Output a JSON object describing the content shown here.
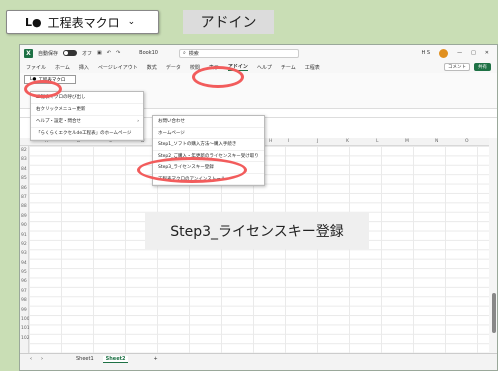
{
  "callout": {
    "icon": "L●",
    "label": "工程表マクロ",
    "chevron": "⌄"
  },
  "addin_tag": "アドイン",
  "window": {
    "titlebar": {
      "autosave": "自動保存",
      "autosave_state": "オフ",
      "filename": "Book10",
      "search_placeholder": "検索",
      "user_initials": "H S",
      "minimize": "—",
      "maximize": "□",
      "close": "✕"
    },
    "ribbon_tabs": [
      "ファイル",
      "ホーム",
      "挿入",
      "ページレイアウト",
      "数式",
      "データ",
      "校閲",
      "表示",
      "アドイン",
      "ヘルプ",
      "チーム",
      "工程表"
    ],
    "active_tab": "アドイン",
    "comment_button": "コメント",
    "share_button": "共有",
    "ribbon_button": "工程表マクロ",
    "column_headers": [
      "A",
      "B",
      "C",
      "D",
      "E",
      "F",
      "G",
      "H",
      "I",
      "J",
      "K",
      "L",
      "M",
      "N",
      "O"
    ],
    "row_numbers": [
      "82",
      "83",
      "84",
      "85",
      "86",
      "87",
      "88",
      "89",
      "90",
      "91",
      "92",
      "93",
      "94",
      "95",
      "96",
      "97",
      "98",
      "99",
      "100",
      "101",
      "102"
    ],
    "sheets": [
      "Sheet1",
      "Sheet2"
    ],
    "active_sheet": "Sheet2",
    "add_sheet": "+",
    "menu1": [
      {
        "label": "工程表マクロの呼び出し",
        "arrow": ""
      },
      {
        "label": "右クリックメニュー更新",
        "arrow": ""
      },
      {
        "label": "ヘルプ・設定・問合せ",
        "arrow": "›"
      },
      {
        "label": "「らくらくエクセルde工程表」のホームページ",
        "arrow": ""
      }
    ],
    "menu2": [
      {
        "label": "お問い合わせ"
      },
      {
        "label": "ホームページ"
      },
      {
        "label": "Step1_ソフトの購入方法～購入手続き"
      },
      {
        "label": "Step2_ご購入・年更新のライセンスキー受け取り"
      },
      {
        "label": "Step3_ライセンスキー登録"
      },
      {
        "label": "工程表マクロのアンインストール"
      }
    ]
  },
  "overlay_label": "Step3_ライセンスキー登録",
  "colors": {
    "accent": "#1e7145",
    "highlight_ring": "#f25c5c",
    "background": "#c9deb5"
  }
}
